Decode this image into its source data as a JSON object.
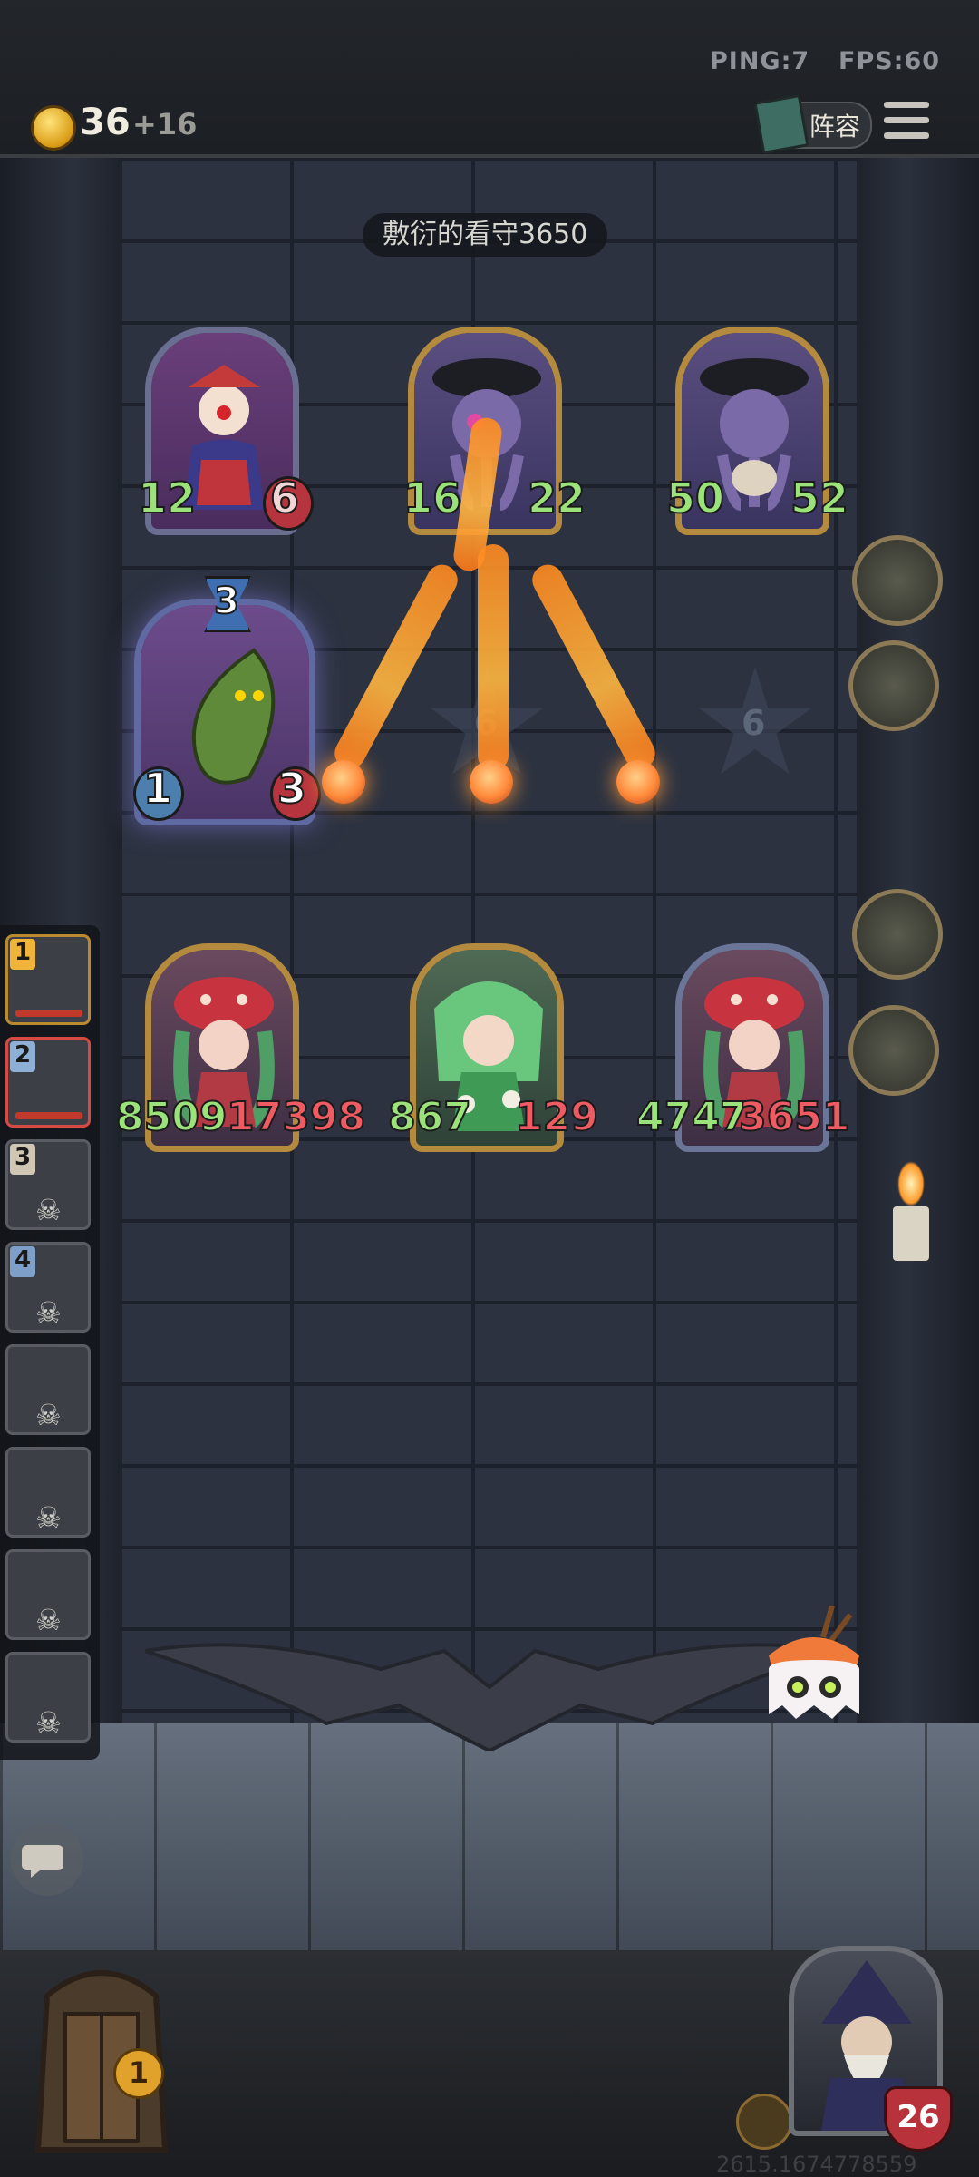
{
  "status": {
    "ping": "PING:7",
    "fps": "FPS:60"
  },
  "resources": {
    "gold": "36",
    "gold_income": "+16"
  },
  "lineup_button": "阵容",
  "enemy_name": "敷衍的看守3650",
  "enemy_cards": [
    {
      "atk": "12",
      "hp": "6"
    },
    {
      "atk": "16",
      "hp": "22"
    },
    {
      "atk": "50",
      "hp": "52"
    }
  ],
  "center_card": {
    "tier": "3",
    "atk": "1",
    "hp": "3"
  },
  "star_slots": [
    "6",
    "6"
  ],
  "player_cards": [
    {
      "atk": "8509",
      "hp": "17398"
    },
    {
      "atk": "867",
      "hp": "129"
    },
    {
      "atk": "4747",
      "hp": "3651"
    }
  ],
  "roster": [
    "1",
    "2",
    "3",
    "4",
    "",
    "",
    "",
    ""
  ],
  "shop_count": "1",
  "hero_health": "26",
  "user_id": "2615.1674778559"
}
